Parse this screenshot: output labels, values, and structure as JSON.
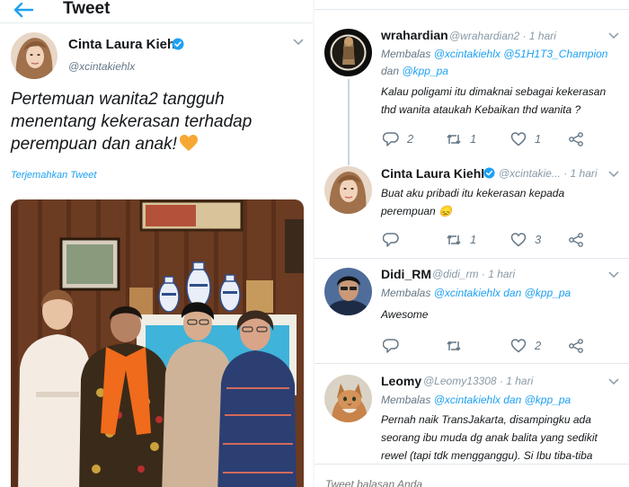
{
  "header": {
    "title": "Tweet"
  },
  "tweet": {
    "author_name": "Cinta Laura Kiehl",
    "author_handle": "@xcintakiehlx",
    "text": "Pertemuan wanita2 tangguh menentang kekerasan terhadap perempuan dan anak!",
    "translate_label": "Terjemahkan Tweet",
    "accent_color": "#1da1f2"
  },
  "replies": [
    {
      "name": "wrahardian",
      "handle": "@wrahardian2",
      "time": "· 1 hari",
      "reply_to_prefix": "Membalas ",
      "reply_to_line1": "@xcintakiehlx @51H1T3_Champion",
      "reply_to_line2_prefix": "dan ",
      "reply_to_line2": "@kpp_pa",
      "text": "Kalau poligami itu dimaknai sebagai kekerasan thd wanita ataukah Kebaikan thd wanita ?",
      "replies": "2",
      "retweets": "1",
      "likes": "1"
    },
    {
      "name": "Cinta Laura Kiehl",
      "handle": "@xcintakie...",
      "time": "· 1 hari",
      "text": "Buat aku pribadi itu kekerasan kepada perempuan 😞",
      "replies": "",
      "retweets": "1",
      "likes": "3"
    },
    {
      "name": "Didi_RM",
      "handle": "@didi_rm",
      "time": "· 1 hari",
      "reply_to_prefix": "Membalas ",
      "reply_to_line1": "@xcintakiehlx",
      "reply_to_mid": " dan ",
      "reply_to_line1b": "@kpp_pa",
      "text": "Awesome",
      "replies": "",
      "retweets": "",
      "likes": "2"
    },
    {
      "name": "Leomy",
      "handle": "@Leomy13308",
      "time": "· 1 hari",
      "reply_to_prefix": "Membalas ",
      "reply_to_line1": "@xcintakiehlx",
      "reply_to_mid": " dan ",
      "reply_to_line1b": "@kpp_pa",
      "text": "Pernah naik TransJakarta, disampingku ada seorang ibu muda dg anak balita yang sedikit rewel (tapi tdk mengganggu). Si Ibu tiba-tiba"
    }
  ],
  "compose": {
    "placeholder": "Tweet balasan Anda"
  }
}
